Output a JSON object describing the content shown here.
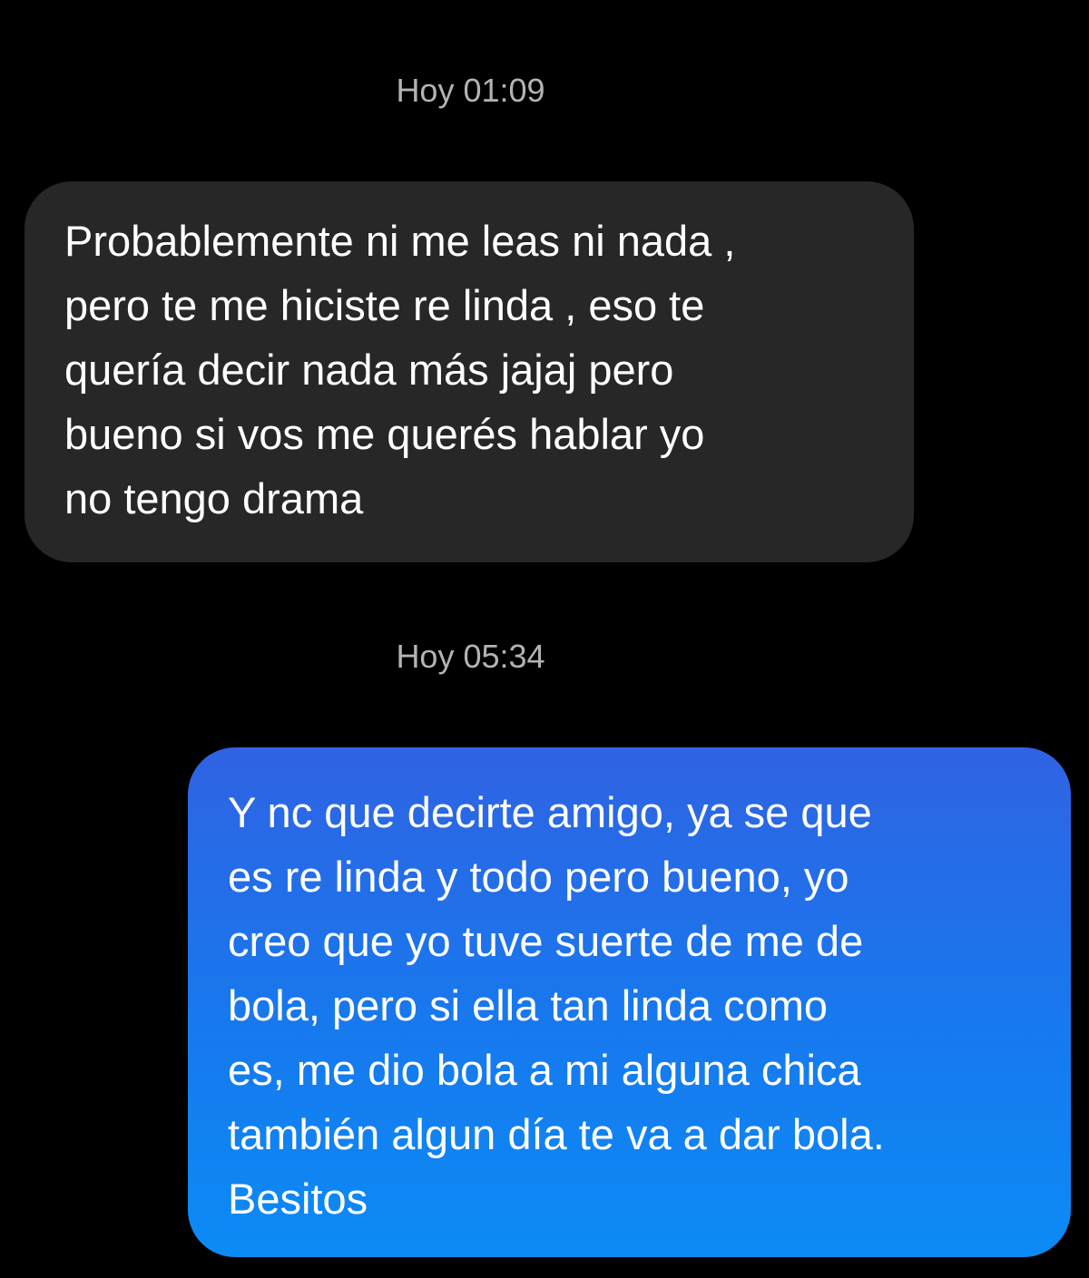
{
  "conversation": {
    "messages": [
      {
        "timestamp": "Hoy 01:09",
        "direction": "incoming",
        "lines": [
          "Probablemente ni me leas ni nada ,",
          "pero te me hiciste re linda , eso te",
          "quería decir nada más jajaj pero",
          "bueno si vos me querés hablar yo",
          "no tengo drama"
        ]
      },
      {
        "timestamp": "Hoy 05:34",
        "direction": "outgoing",
        "lines": [
          "Y nc que decirte amigo, ya se que",
          "es re linda y todo pero bueno, yo",
          "creo que yo tuve suerte de me de",
          "bola, pero si ella tan linda como",
          "es, me dio bola a mi alguna chica",
          "también algun día te va a dar bola.",
          "Besitos"
        ]
      }
    ]
  },
  "colors": {
    "background": "#000000",
    "incoming_bubble": "#272727",
    "outgoing_bubble_top": "#2f63e3",
    "outgoing_bubble_bottom": "#0b8bf5",
    "timestamp_text": "#b3b3b3",
    "message_text": "#ffffff"
  }
}
